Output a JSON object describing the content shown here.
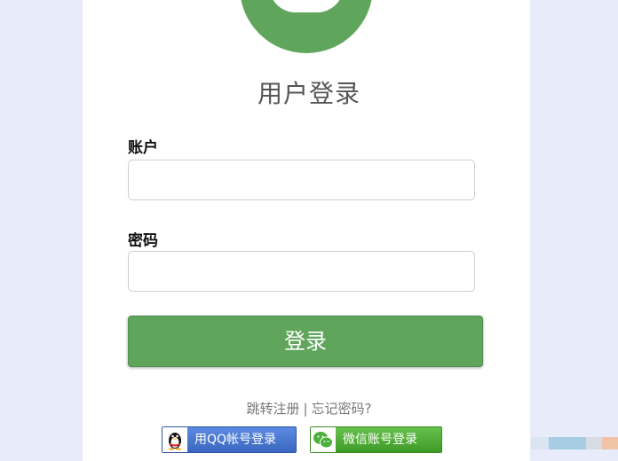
{
  "title": "用户登录",
  "account": {
    "label": "账户",
    "value": ""
  },
  "password": {
    "label": "密码",
    "value": ""
  },
  "login_button": "登录",
  "links": {
    "register": "跳转注册",
    "separator": "|",
    "forgot": "忘记密码?"
  },
  "social": {
    "qq_label": "用QQ帐号登录",
    "wechat_label": "微信账号登录"
  },
  "icons": [
    "user-avatar-icon",
    "qq-penguin-icon",
    "wechat-icon"
  ],
  "colors": {
    "accent_green": "#5fa55c",
    "qq_blue": "#3a67bf",
    "wechat_green": "#3f9a28",
    "background": "#e7ebfa",
    "panel": "#ffffff"
  }
}
